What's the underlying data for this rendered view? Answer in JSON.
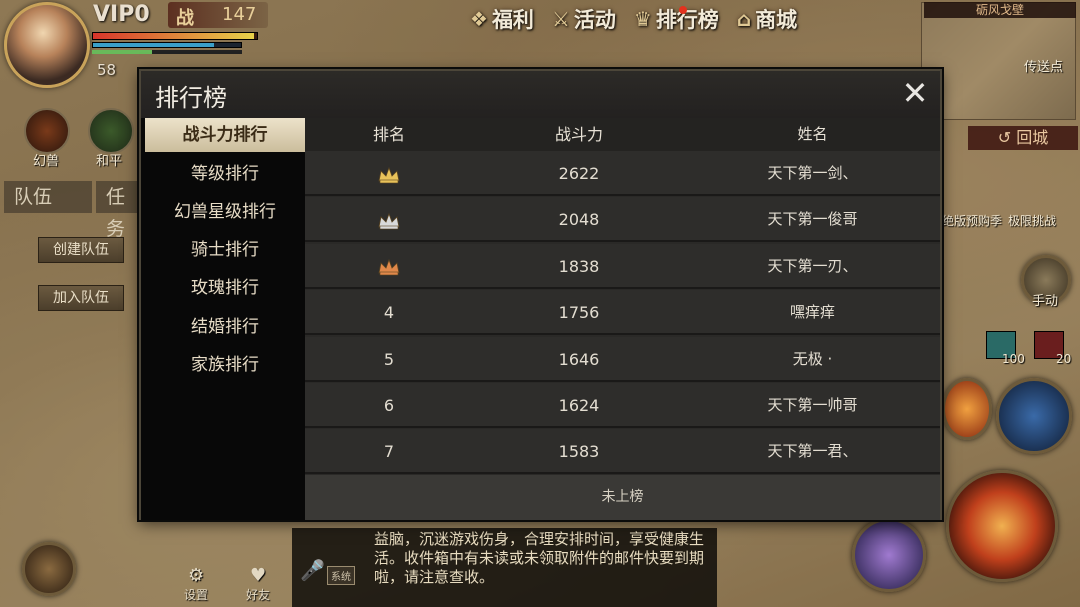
{
  "hud": {
    "vip": "VIP0",
    "power_tag": "战",
    "power_value": "147",
    "level": "58",
    "hp_fraction": 0.98,
    "mp_fraction": 0.82,
    "xp_fraction": 0.4
  },
  "top_menu": [
    {
      "label": "福利",
      "icon": "gift-icon"
    },
    {
      "label": "活动",
      "icon": "crossed-swords-icon"
    },
    {
      "label": "排行榜",
      "icon": "crown-icon"
    },
    {
      "label": "商城",
      "icon": "shop-icon"
    }
  ],
  "minimap": {
    "name": "砺风戈壁",
    "point_label": "传送点",
    "return_label": "回城"
  },
  "left_hud": {
    "pet_label": "幻兽",
    "peace_label": "和平",
    "tab_team": "队伍",
    "tab_task": "任务",
    "create_team": "创建队伍",
    "join_team": "加入队伍"
  },
  "right_hud": {
    "auto_label": "手动",
    "item1_count": "100",
    "item2_count": "20",
    "event1": "绝版预购季",
    "event2": "极限挑战"
  },
  "chat": {
    "channel": "系统",
    "message": "益脑，沉迷游戏伤身，合理安排时间，享受健康生活。收件箱中有未读或未领取附件的邮件快要到期啦，请注意查收。"
  },
  "bottom": {
    "settings_label": "设置",
    "friends_label": "好友"
  },
  "dialog": {
    "title": "排行榜",
    "sidebar": [
      {
        "label": "战斗力排行",
        "active": true
      },
      {
        "label": "等级排行",
        "active": false
      },
      {
        "label": "幻兽星级排行",
        "active": false
      },
      {
        "label": "骑士排行",
        "active": false
      },
      {
        "label": "玫瑰排行",
        "active": false
      },
      {
        "label": "结婚排行",
        "active": false
      },
      {
        "label": "家族排行",
        "active": false
      }
    ],
    "columns": {
      "rank": "排名",
      "power": "战斗力",
      "name": "姓名"
    },
    "rows": [
      {
        "rank": "1",
        "crown": "gold",
        "power": "2622",
        "name": "天下第一剑、"
      },
      {
        "rank": "2",
        "crown": "silver",
        "power": "2048",
        "name": "天下第一俊哥"
      },
      {
        "rank": "3",
        "crown": "bronze",
        "power": "1838",
        "name": "天下第一刃、"
      },
      {
        "rank": "4",
        "crown": "",
        "power": "1756",
        "name": "嘿痒痒"
      },
      {
        "rank": "5",
        "crown": "",
        "power": "1646",
        "name": "无极 ·"
      },
      {
        "rank": "6",
        "crown": "",
        "power": "1624",
        "name": "天下第一帅哥"
      },
      {
        "rank": "7",
        "crown": "",
        "power": "1583",
        "name": "天下第一君、"
      }
    ],
    "footer": "未上榜",
    "crown_colors": {
      "gold": "#e8c25a",
      "silver": "#d9d9d9",
      "bronze": "#e0884a"
    }
  }
}
